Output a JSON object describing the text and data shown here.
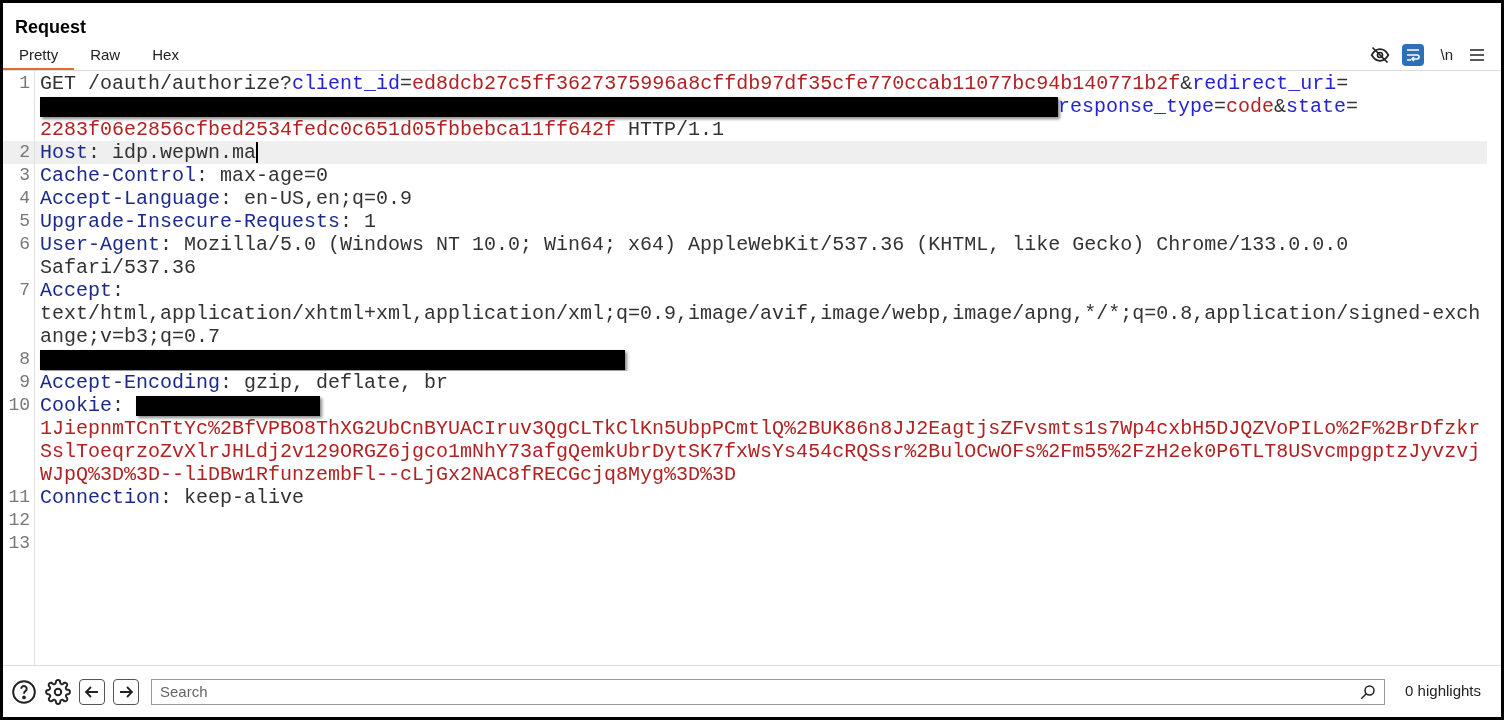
{
  "panel": {
    "title": "Request"
  },
  "tabs": [
    {
      "label": "Pretty",
      "selected": true
    },
    {
      "label": "Raw",
      "selected": false
    },
    {
      "label": "Hex",
      "selected": false
    }
  ],
  "toolbar": {
    "wrap_selected": true,
    "newline_label": "\\n"
  },
  "editor": {
    "lines": [
      {
        "number": "1",
        "current": false,
        "rows": [
          {
            "segments": [
              {
                "kind": "plain",
                "text": "GET /oauth/authorize?"
              },
              {
                "kind": "param",
                "text": "client_id"
              },
              {
                "kind": "plain",
                "text": "="
              },
              {
                "kind": "value",
                "text": "ed8dcb27c5ff3627375996a8cffdb97df35cfe770ccab11077bc94b140771b2f"
              },
              {
                "kind": "plain",
                "text": "&"
              },
              {
                "kind": "param",
                "text": "redirect_uri"
              },
              {
                "kind": "plain",
                "text": "="
              }
            ]
          },
          {
            "segments": [
              {
                "kind": "redaction"
              },
              {
                "kind": "param",
                "text": "response_type"
              },
              {
                "kind": "plain",
                "text": "="
              },
              {
                "kind": "value",
                "text": "code"
              },
              {
                "kind": "plain",
                "text": "&"
              },
              {
                "kind": "param",
                "text": "state"
              },
              {
                "kind": "plain",
                "text": "="
              }
            ]
          },
          {
            "segments": [
              {
                "kind": "value",
                "text": "2283f06e2856cfbed2534fedc0c651d05fbbebca11ff642f"
              },
              {
                "kind": "plain",
                "text": " HTTP/1.1"
              }
            ]
          }
        ]
      },
      {
        "number": "2",
        "current": true,
        "rows": [
          {
            "segments": [
              {
                "kind": "name",
                "text": "Host"
              },
              {
                "kind": "plain",
                "text": ": idp.wepwn.ma"
              }
            ]
          }
        ]
      },
      {
        "number": "3",
        "current": false,
        "rows": [
          {
            "segments": [
              {
                "kind": "name",
                "text": "Cache-Control"
              },
              {
                "kind": "plain",
                "text": ": max-age=0"
              }
            ]
          }
        ]
      },
      {
        "number": "4",
        "current": false,
        "rows": [
          {
            "segments": [
              {
                "kind": "name",
                "text": "Accept-Language"
              },
              {
                "kind": "plain",
                "text": ": en-US,en;q=0.9"
              }
            ]
          }
        ]
      },
      {
        "number": "5",
        "current": false,
        "rows": [
          {
            "segments": [
              {
                "kind": "name",
                "text": "Upgrade-Insecure-Requests"
              },
              {
                "kind": "plain",
                "text": ": 1"
              }
            ]
          }
        ]
      },
      {
        "number": "6",
        "current": false,
        "rows": [
          {
            "segments": [
              {
                "kind": "name",
                "text": "User-Agent"
              },
              {
                "kind": "plain",
                "text": ": Mozilla/5.0 (Windows NT 10.0; Win64; x64) AppleWebKit/537.36 (KHTML, like Gecko) Chrome/133.0.0.0"
              }
            ]
          },
          {
            "segments": [
              {
                "kind": "plain",
                "text": "Safari/537.36"
              }
            ]
          }
        ]
      },
      {
        "number": "7",
        "current": false,
        "rows": [
          {
            "segments": [
              {
                "kind": "name",
                "text": "Accept"
              },
              {
                "kind": "plain",
                "text": ":"
              }
            ]
          },
          {
            "segments": [
              {
                "kind": "plain",
                "text": "text/html,application/xhtml+xml,application/xml;q=0.9,image/avif,image/webp,image/apng,*/*;q=0.8,application/signed-exch"
              }
            ]
          },
          {
            "segments": [
              {
                "kind": "plain",
                "text": "ange;v=b3;q=0.7"
              }
            ]
          }
        ]
      },
      {
        "number": "8",
        "current": false,
        "rows": [
          {
            "segments": [
              {
                "kind": "redaction"
              }
            ]
          }
        ]
      },
      {
        "number": "9",
        "current": false,
        "rows": [
          {
            "segments": [
              {
                "kind": "name",
                "text": "Accept-Encoding"
              },
              {
                "kind": "plain",
                "text": ": gzip, deflate, br"
              }
            ]
          }
        ]
      },
      {
        "number": "10",
        "current": false,
        "rows": [
          {
            "segments": [
              {
                "kind": "name",
                "text": "Cookie"
              },
              {
                "kind": "plain",
                "text": ": "
              },
              {
                "kind": "redaction"
              }
            ]
          },
          {
            "segments": [
              {
                "kind": "value",
                "text": "1JiepnmTCnTtYc%2BfVPBO8ThXG2UbCnBYUACIruv3QgCLTkClKn5UbpPCmtlQ%2BUK86n8JJ2EagtjsZFvsmts1s7Wp4cxbH5DJQZVoPILo%2F%2BrDfzkr"
              }
            ]
          },
          {
            "segments": [
              {
                "kind": "value",
                "text": "SslToeqrzoZvXlrJHLdj2v129ORGZ6jgco1mNhY73afgQemkUbrDytSK7fxWsYs454cRQSsr%2BulOCwOFs%2Fm55%2FzH2ek0P6TLT8USvcmpgptzJyvzvj"
              }
            ]
          },
          {
            "segments": [
              {
                "kind": "value",
                "text": "WJpQ%3D%3D--liDBw1RfunzembFl--cLjGx2NAC8fRECGcjq8Myg%3D%3D"
              }
            ]
          }
        ]
      },
      {
        "number": "11",
        "current": false,
        "rows": [
          {
            "segments": [
              {
                "kind": "name",
                "text": "Connection"
              },
              {
                "kind": "plain",
                "text": ": keep-alive"
              }
            ]
          }
        ]
      },
      {
        "number": "12",
        "current": false
      },
      {
        "number": "13",
        "current": false
      }
    ]
  },
  "footer": {
    "search": {
      "placeholder": "Search"
    },
    "highlights": "0 highlights"
  }
}
